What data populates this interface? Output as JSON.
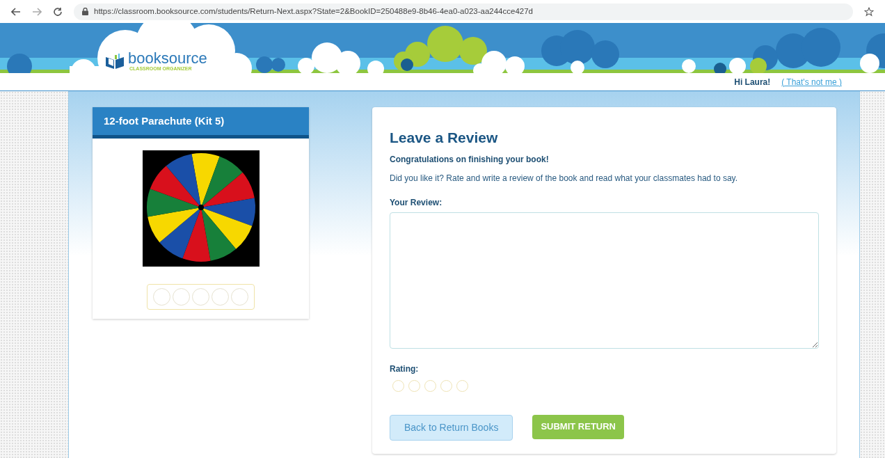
{
  "browser": {
    "url": "https://classroom.booksource.com/students/Return-Next.aspx?State=2&BookID=250488e9-8b46-4ea0-a023-aa244cce427d"
  },
  "logo": {
    "name": "booksource",
    "tagline": "CLASSROOM ORGANIZER"
  },
  "user": {
    "greeting": "Hi Laura!",
    "link": "( That's not me )"
  },
  "book": {
    "title": "12-foot Parachute (Kit 5)",
    "stars": 0
  },
  "review": {
    "title": "Leave a Review",
    "subtitle": "Congratulations on finishing your book!",
    "intro": "Did you like it? Rate and write a review of the book and read what your classmates had to say.",
    "field_label": "Your Review:",
    "rating_label": "Rating:",
    "stars": 0
  },
  "buttons": [
    {
      "label": "Back to Return Books",
      "kind": "secondary"
    },
    {
      "label": "SUBMIT RETURN",
      "kind": "primary"
    }
  ]
}
